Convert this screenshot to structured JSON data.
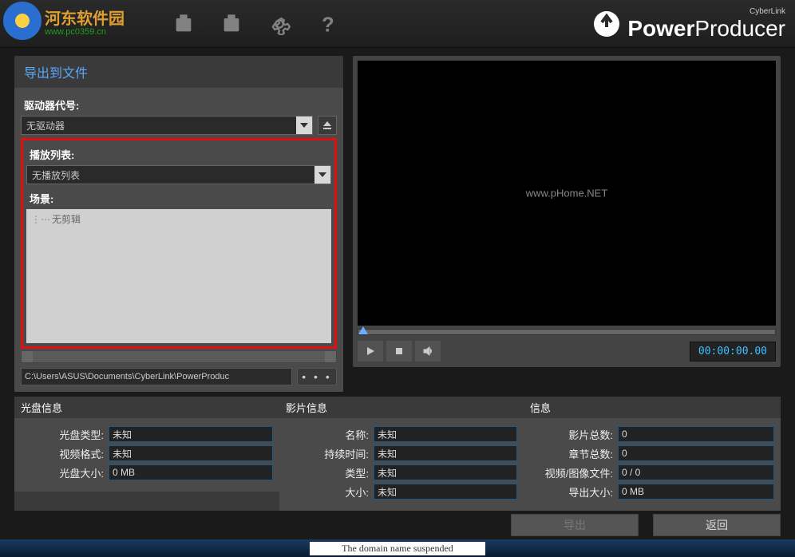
{
  "watermark": {
    "line1": "河东软件园",
    "line2": "www.pc0359.cn"
  },
  "brand": {
    "company": "CyberLink",
    "name_bold": "Power",
    "name_light": "Producer"
  },
  "panel": {
    "title": "导出到文件",
    "drive_label": "驱动器代号:",
    "drive_value": "无驱动器",
    "playlist_label": "播放列表:",
    "playlist_value": "无播放列表",
    "scene_label": "场景:",
    "scene_item": "无剪辑",
    "path": "C:\\Users\\ASUS\\Documents\\CyberLink\\PowerProduc",
    "browse": "• • •"
  },
  "preview": {
    "watermark": "www.pHome.NET",
    "timecode": "00:00:00.00"
  },
  "info": {
    "disc": {
      "header": "光盘信息",
      "type_label": "光盘类型:",
      "type_value": "未知",
      "format_label": "视频格式:",
      "format_value": "未知",
      "size_label": "光盘大小:",
      "size_value": "0 MB"
    },
    "movie": {
      "header": "影片信息",
      "name_label": "名称:",
      "name_value": "未知",
      "duration_label": "持续时间:",
      "duration_value": "未知",
      "type_label": "类型:",
      "type_value": "未知",
      "size_label": "大小:",
      "size_value": "未知"
    },
    "general": {
      "header": "信息",
      "movies_label": "影片总数:",
      "movies_value": "0",
      "chapters_label": "章节总数:",
      "chapters_value": "0",
      "files_label": "视频/图像文件:",
      "files_value": "0 / 0",
      "export_label": "导出大小:",
      "export_value": "0 MB"
    }
  },
  "actions": {
    "export": "导出",
    "back": "返回"
  },
  "footer": "The domain name suspended"
}
